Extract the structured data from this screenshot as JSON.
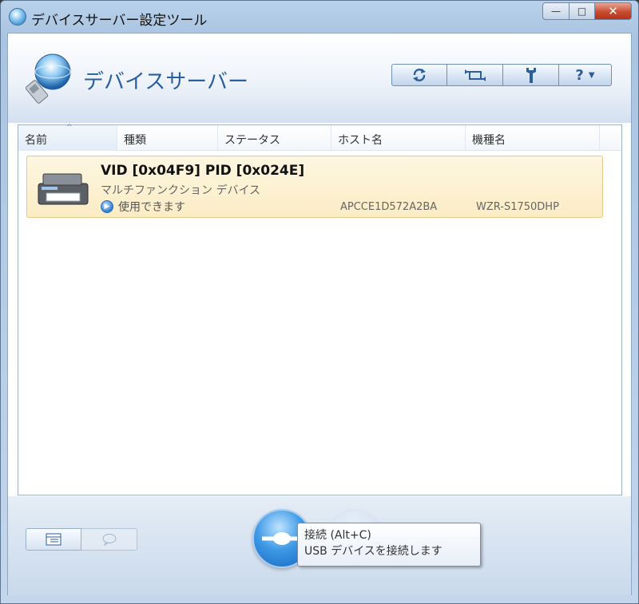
{
  "window": {
    "title": "デバイスサーバー設定ツール",
    "controls": {
      "minimize": "—",
      "maximize": "□",
      "close": "✕"
    }
  },
  "header": {
    "app_title": "デバイスサーバー",
    "toolbar": [
      {
        "icon": "refresh-icon"
      },
      {
        "icon": "switch-icon"
      },
      {
        "icon": "settings-icon"
      },
      {
        "icon": "help-icon",
        "label": "?"
      }
    ]
  },
  "list": {
    "columns": [
      "名前",
      "種類",
      "ステータス",
      "ホスト名",
      "機種名"
    ],
    "sorted_column": "名前",
    "rows": [
      {
        "icon": "printer-icon",
        "name": "VID [0x04F9] PID [0x024E]",
        "type": "マルチファンクション デバイス",
        "status": "使用できます",
        "host": "APCCE1D572A2BA",
        "model": "WZR-S1750DHP"
      }
    ]
  },
  "footer": {
    "view_buttons": [
      {
        "icon": "list-view-icon",
        "active": true
      },
      {
        "icon": "comment-icon",
        "active": false
      }
    ],
    "connect_button": {
      "icon": "connect-plug-icon"
    },
    "disconnect_button": {
      "icon": "disconnect-plug-icon",
      "enabled": false
    }
  },
  "tooltip": {
    "title": "接続 (Alt+C)",
    "description": "USB デバイスを接続します"
  },
  "colors": {
    "accent": "#2a5fa0",
    "row_highlight": "#fbecc4",
    "connect_blue": "#3f9ae6"
  }
}
